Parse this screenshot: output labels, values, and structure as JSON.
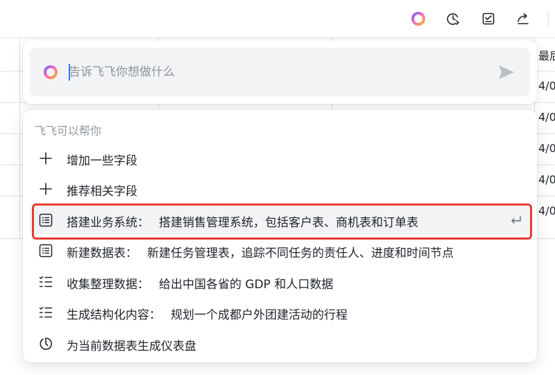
{
  "table": {
    "header_partial": "最后",
    "row_values": [
      "4/0",
      "4/0",
      "4/0",
      "4/0",
      "4/0"
    ]
  },
  "toolbar": {
    "icons": [
      "ai-assistant-icon",
      "history-icon",
      "checklist-icon",
      "share-icon"
    ]
  },
  "input": {
    "placeholder": "告诉飞飞你想做什么",
    "value": ""
  },
  "menu": {
    "title": "飞飞可以帮你",
    "items": [
      {
        "icon": "plus-icon",
        "label": "增加一些字段",
        "prompt": ""
      },
      {
        "icon": "plus-icon",
        "label": "推荐相关字段",
        "prompt": ""
      },
      {
        "icon": "table-icon",
        "label": "搭建业务系统：",
        "prompt": "搭建销售管理系统，包括客户表、商机表和订单表",
        "selected": true
      },
      {
        "icon": "table-icon",
        "label": "新建数据表：",
        "prompt": "新建任务管理表，追踪不同任务的责任人、进度和时间节点"
      },
      {
        "icon": "checklist-lines-icon",
        "label": "收集整理数据：",
        "prompt": "给出中国各省的 GDP 和人口数据"
      },
      {
        "icon": "checklist-lines-icon",
        "label": "生成结构化内容：",
        "prompt": "规划一个成都户外团建活动的行程"
      },
      {
        "icon": "dashboard-icon",
        "label": "为当前数据表生成仪表盘",
        "prompt": ""
      }
    ]
  },
  "colors": {
    "accent": "#3370ff",
    "highlight_border": "#e53c2f",
    "muted_text": "#8f959e",
    "item_hover_bg": "#f2f3f5"
  }
}
